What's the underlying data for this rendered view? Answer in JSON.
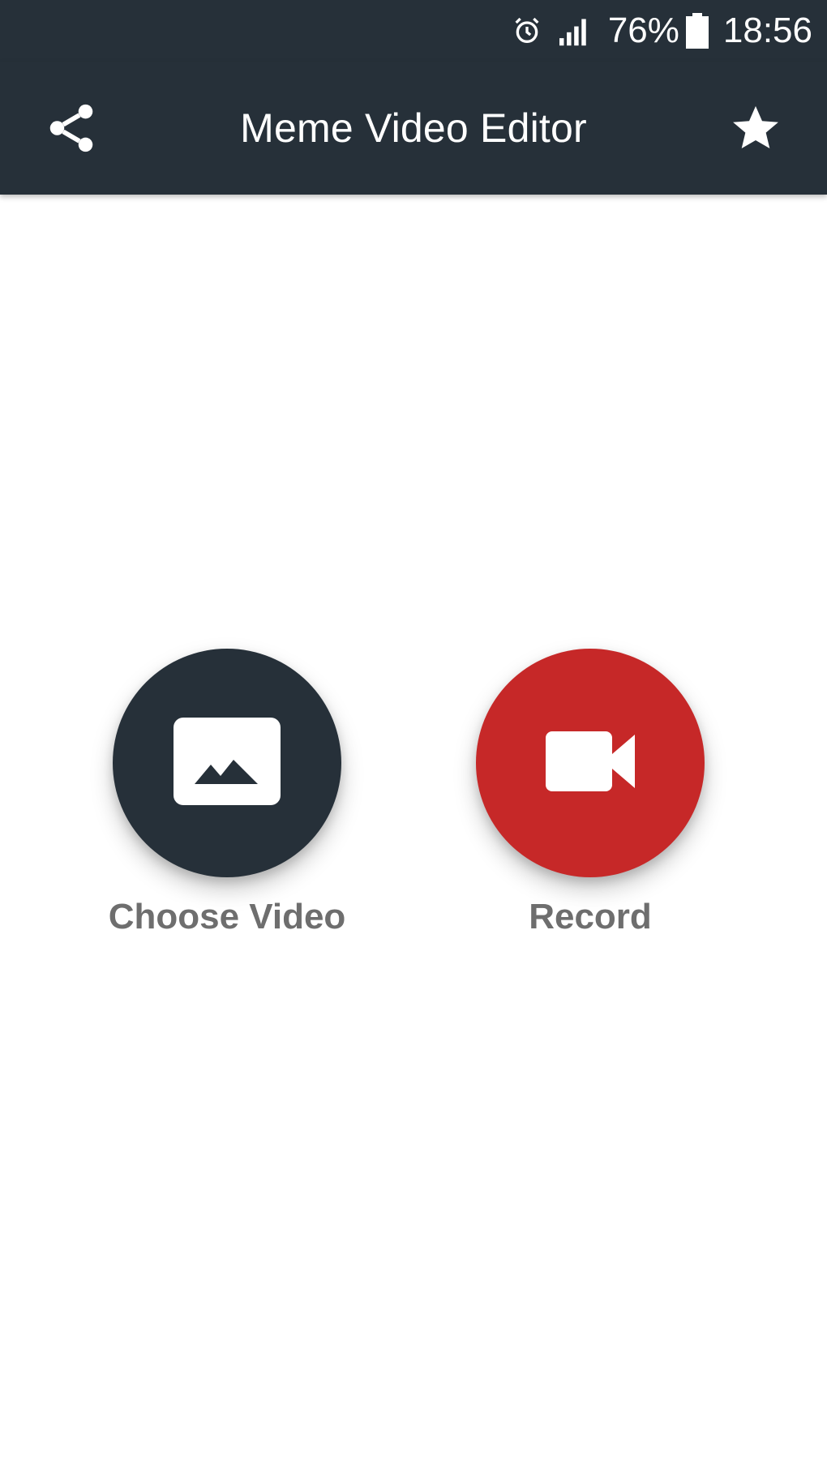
{
  "status_bar": {
    "battery_percent": "76%",
    "time": "18:56",
    "icons": [
      "alarm-icon",
      "signal-icon",
      "battery-icon"
    ]
  },
  "app_bar": {
    "title": "Meme Video Editor",
    "left_icon": "share-icon",
    "right_icon": "star-icon",
    "background": "#263039"
  },
  "actions": {
    "choose": {
      "label": "Choose Video",
      "icon": "image-icon",
      "color": "#263039"
    },
    "record": {
      "label": "Record",
      "icon": "video-camera-icon",
      "color": "#c62828"
    }
  }
}
